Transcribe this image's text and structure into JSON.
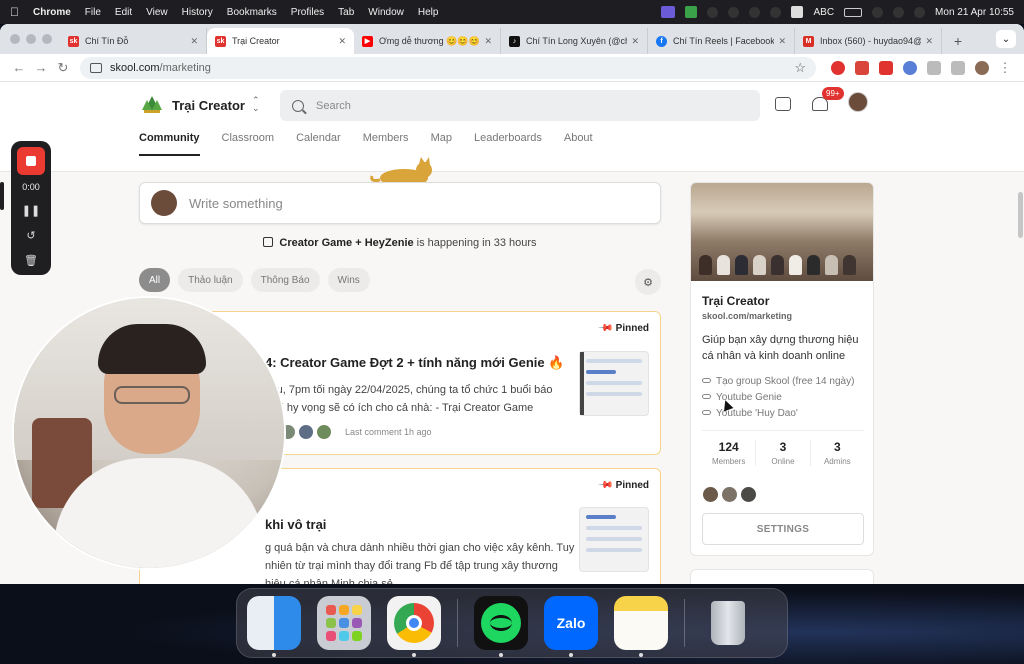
{
  "menubar": {
    "app": "Chrome",
    "items": [
      "File",
      "Edit",
      "View",
      "History",
      "Bookmarks",
      "Profiles",
      "Tab",
      "Window",
      "Help"
    ],
    "input_source": "ABC",
    "clock": "Mon 21 Apr  10:55"
  },
  "tabs": [
    {
      "title": "Chí Tín Đỗ",
      "fav_color": "#e0332f",
      "fav_text": "sk"
    },
    {
      "title": "Trại Creator",
      "fav_color": "#e0332f",
      "fav_text": "sk",
      "active": true
    },
    {
      "title": "Ơmg dễ thương 😊😊😊",
      "fav_color": "#ff0000",
      "fav_text": "▶"
    },
    {
      "title": "Chí Tín Long Xuyên (@chi",
      "fav_color": "#111111",
      "fav_text": "♪"
    },
    {
      "title": "Chí Tín Reels | Facebook",
      "fav_color": "#1877f2",
      "fav_text": "f"
    },
    {
      "title": "Inbox (560) - huydao94@",
      "fav_color": "#d93025",
      "fav_text": "M"
    }
  ],
  "address": {
    "host": "skool.com",
    "path": "/marketing"
  },
  "extensions": [
    "#e0332f",
    "#d9453a",
    "#e0332f",
    "#5a7fd6",
    "#888888",
    "#888888"
  ],
  "header": {
    "brand": "Trại Creator",
    "search_placeholder": "Search",
    "notifications": "99+",
    "nav": [
      "Community",
      "Classroom",
      "Calendar",
      "Members",
      "Map",
      "Leaderboards",
      "About"
    ]
  },
  "composer": {
    "placeholder": "Write something"
  },
  "event": {
    "name": "Creator Game + HeyZenie",
    "suffix": " is happening in 33 hours"
  },
  "filters": [
    "All",
    "Thảo luận",
    "Thông Báo",
    "Wins"
  ],
  "posts": [
    {
      "pinned": "Pinned",
      "title": "4: Creator Game Đợt 2 + tính năng mới Genie 🔥",
      "body": "sau, 7pm tối ngày 22/04/2025, chúng ta tổ chức 1 buổi báo mới hy vọng sẽ có ích cho cả nhà: - Trại Creator Game",
      "last_comment": "Last comment 1h ago"
    },
    {
      "pinned": "Pinned",
      "title": "khi vô trại",
      "body": "g quá bận và chưa dành nhiều thời gian cho việc xây kênh. Tuy nhiên từ trại mình thay đổi trang Fb để tập trung xây thương hiệu cá nhân Minh chia sẻ"
    }
  ],
  "group_card": {
    "name": "Trại Creator",
    "url": "skool.com/marketing",
    "description": "Giúp bạn xây dựng thương hiệu cá nhân và kinh doanh online",
    "links": [
      "Tạo group Skool (free 14 ngày)",
      "Youtube Genie",
      "Youtube 'Huy Dao'"
    ],
    "stats": [
      {
        "value": "124",
        "label": "Members"
      },
      {
        "value": "3",
        "label": "Online"
      },
      {
        "value": "3",
        "label": "Admins"
      }
    ],
    "settings_label": "SETTINGS"
  },
  "recorder": {
    "time": "0:00"
  },
  "dock": [
    "finder",
    "launchpad",
    "chrome",
    "spotify",
    "zalo",
    "notes",
    "trash"
  ],
  "dock_zalo_label": "Zalo"
}
